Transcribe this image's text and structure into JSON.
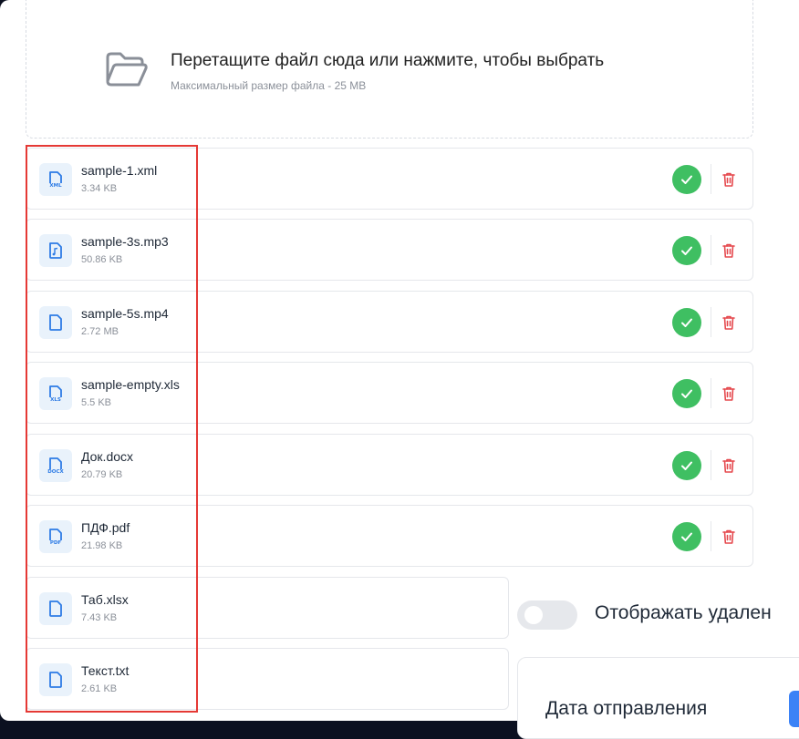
{
  "upload": {
    "title": "Перетащите файл сюда или нажмите, чтобы выбрать",
    "subtitle": "Максимальный размер файла - 25 MB"
  },
  "files": [
    {
      "name": "sample-1.xml",
      "size": "3.34 KB",
      "tag": "XML",
      "icon": "file-xml-icon"
    },
    {
      "name": "sample-3s.mp3",
      "size": "50.86 KB",
      "tag": "",
      "icon": "file-audio-icon"
    },
    {
      "name": "sample-5s.mp4",
      "size": "2.72 MB",
      "tag": "",
      "icon": "file-icon"
    },
    {
      "name": "sample-empty.xls",
      "size": "5.5 KB",
      "tag": "XLS",
      "icon": "file-xls-icon"
    },
    {
      "name": "Док.docx",
      "size": "20.79 KB",
      "tag": "DOCX",
      "icon": "file-docx-icon"
    },
    {
      "name": "ПДФ.pdf",
      "size": "21.98 KB",
      "tag": "PDF",
      "icon": "file-pdf-icon"
    },
    {
      "name": "Таб.xlsx",
      "size": "7.43 KB",
      "tag": "",
      "icon": "file-icon"
    },
    {
      "name": "Текст.txt",
      "size": "2.61 KB",
      "tag": "",
      "icon": "file-icon"
    }
  ],
  "toggle": {
    "label": "Отображать удален",
    "checked": false
  },
  "panel": {
    "title": "Дата отправления"
  },
  "colors": {
    "success": "#3fbf62",
    "danger": "#e5484d",
    "accent": "#2d7be5",
    "highlight": "#e53935"
  }
}
